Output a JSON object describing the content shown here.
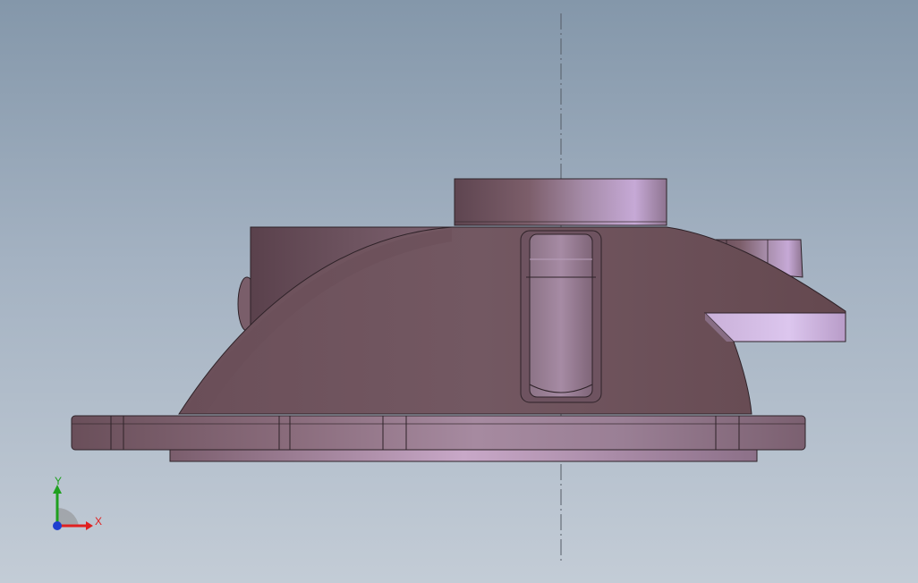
{
  "viewport": {
    "background_top": "#8497aa",
    "background_bottom": "#c3ccd6",
    "model_color": "#7a5c66",
    "highlight_color": "#d9c2ea"
  },
  "triad": {
    "x_label": "X",
    "y_label": "Y",
    "x_color": "#e02020",
    "y_color": "#1fa01f",
    "z_color": "#1f3fd0"
  }
}
